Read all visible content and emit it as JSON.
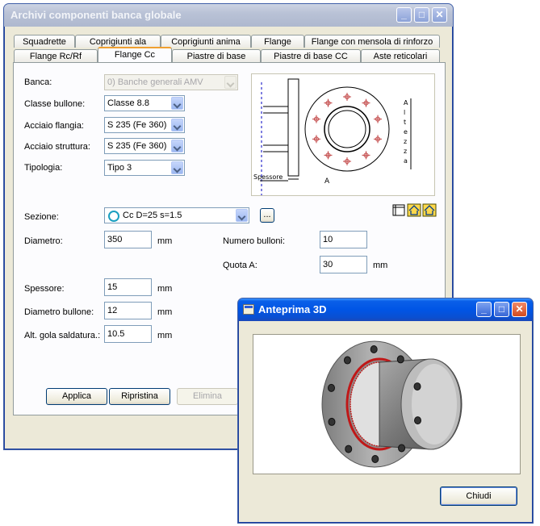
{
  "main_window": {
    "title": "Archivi componenti banca globale",
    "tabs_row1": [
      "Squadrette",
      "Coprigiunti ala",
      "Coprigiunti anima",
      "Flange",
      "Flange con mensola di rinforzo"
    ],
    "tabs_row2": [
      "Flange Rc/Rf",
      "Flange Cc",
      "Piastre di base",
      "Piastre di base CC",
      "Aste reticolari"
    ],
    "selected_tab": "Flange Cc",
    "form": {
      "banca_label": "Banca:",
      "banca_value": "0) Banche generali AMV",
      "classe_label": "Classe bullone:",
      "classe_value": "Classe 8.8",
      "acciaio_flangia_label": "Acciaio flangia:",
      "acciaio_flangia_value": "S 235 (Fe 360)",
      "acciaio_struttura_label": "Acciaio struttura:",
      "acciaio_struttura_value": "S 235 (Fe 360)",
      "tipologia_label": "Tipologia:",
      "tipologia_value": "Tipo 3",
      "sezione_label": "Sezione:",
      "sezione_value": "Cc D=25 s=1.5",
      "browse_label": "...",
      "diametro_label": "Diametro:",
      "diametro_value": "350",
      "numero_bulloni_label": "Numero bulloni:",
      "numero_bulloni_value": "10",
      "quota_a_label": "Quota A:",
      "quota_a_value": "30",
      "spessore_label": "Spessore:",
      "spessore_value": "15",
      "diametro_bullone_label": "Diametro bullone:",
      "diametro_bullone_value": "12",
      "alt_gola_label": "Alt. gola saldatura.:",
      "alt_gola_value": "10.5",
      "unit_mm": "mm"
    },
    "drawing": {
      "spessore_label": "Spessore",
      "a_label": "A",
      "altezza_letters": [
        "A",
        "l",
        "t",
        "e",
        "z",
        "z",
        "a"
      ]
    },
    "buttons": {
      "applica": "Applica",
      "ripristina": "Ripristina",
      "elimina": "Elimina"
    }
  },
  "preview_window": {
    "title": "Anteprima 3D",
    "close_button": "Chiudi"
  },
  "colors": {
    "titlebar_active": "#0055e5",
    "titlebar_inactive": "#b9c2d6",
    "window_bg": "#ece9d8",
    "tab_selected_accent": "#f0a030",
    "weld_red": "#d01010"
  }
}
